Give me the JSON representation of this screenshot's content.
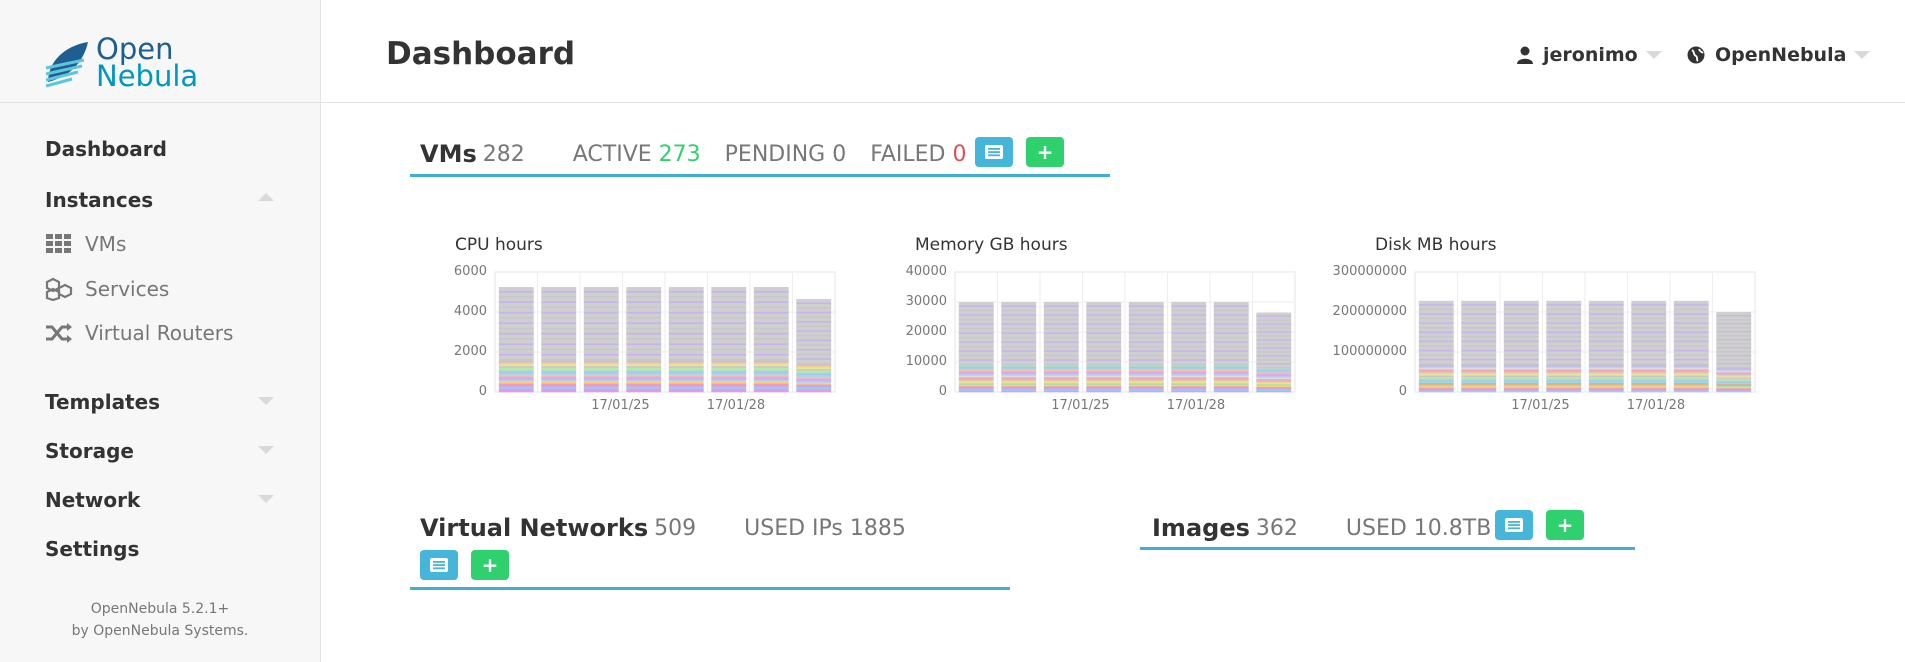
{
  "brand": {
    "line1": "Open",
    "line2": "Nebula"
  },
  "header": {
    "title": "Dashboard",
    "user": "jeronimo",
    "zone": "OpenNebula"
  },
  "sidebar": {
    "items": [
      {
        "label": "Dashboard"
      },
      {
        "label": "Instances"
      },
      {
        "label": "VMs",
        "icon": "grid-icon"
      },
      {
        "label": "Services",
        "icon": "cubes-icon"
      },
      {
        "label": "Virtual Routers",
        "icon": "shuffle-icon"
      },
      {
        "label": "Templates"
      },
      {
        "label": "Storage"
      },
      {
        "label": "Network"
      },
      {
        "label": "Settings"
      }
    ],
    "version_line1": "OpenNebula 5.2.1+",
    "version_line2": "by OpenNebula Systems."
  },
  "vms": {
    "title": "VMs",
    "count": "282",
    "active_label": "ACTIVE",
    "active": "273",
    "pending_label": "PENDING",
    "pending": "0",
    "failed_label": "FAILED",
    "failed": "0"
  },
  "vnets": {
    "title": "Virtual Networks",
    "count": "509",
    "used_ips_label": "USED IPs",
    "used_ips": "1885"
  },
  "images": {
    "title": "Images",
    "count": "362",
    "used_label": "USED",
    "used": "10.8TB"
  },
  "colors": {
    "accent": "#3fb0cf",
    "list_button": "#45b5d9",
    "add_button": "#2ed16e",
    "active": "#2ed16e",
    "failed": "#e05050"
  },
  "chart_data": [
    {
      "type": "bar",
      "title": "CPU hours",
      "yticks": [
        "6000",
        "4000",
        "2000",
        "0"
      ],
      "ylim": [
        0,
        6000
      ],
      "xticks": [
        "17/01/25",
        "17/01/28"
      ],
      "values": [
        5250,
        5250,
        5250,
        5250,
        5250,
        5250,
        5250,
        4650
      ]
    },
    {
      "type": "bar",
      "title": "Memory GB hours",
      "yticks": [
        "40000",
        "30000",
        "20000",
        "10000",
        "0"
      ],
      "ylim": [
        0,
        40000
      ],
      "xticks": [
        "17/01/25",
        "17/01/28"
      ],
      "values": [
        30000,
        30000,
        30000,
        30000,
        30000,
        30000,
        30000,
        26500
      ]
    },
    {
      "type": "bar",
      "title": "Disk MB hours",
      "yticks": [
        "300000000",
        "200000000",
        "100000000",
        "0"
      ],
      "ylim": [
        0,
        300000000
      ],
      "xticks": [
        "17/01/25",
        "17/01/28"
      ],
      "values": [
        228000000,
        228000000,
        228000000,
        228000000,
        228000000,
        228000000,
        228000000,
        200000000
      ]
    }
  ]
}
